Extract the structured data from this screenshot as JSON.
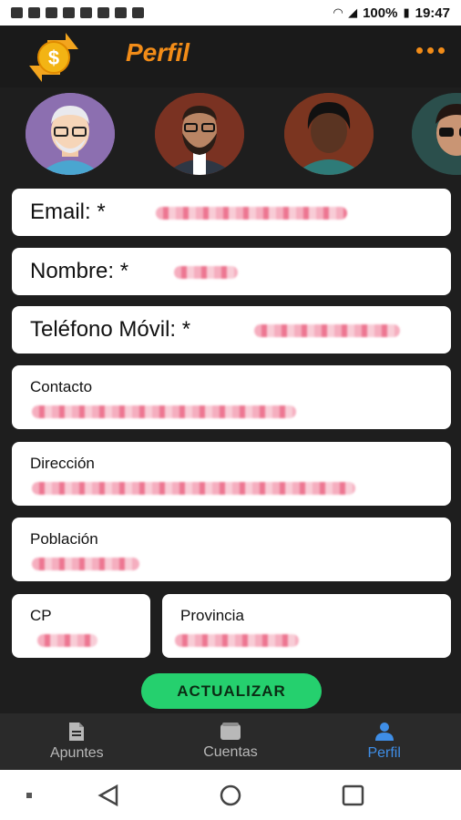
{
  "status_bar": {
    "battery": "100%",
    "time": "19:47"
  },
  "app_bar": {
    "title": "Perfil",
    "accent_color": "#f28c18",
    "logo_icon": "dollar-coin-arrows-icon",
    "menu_icon": "more-horizontal-icon"
  },
  "avatars": [
    {
      "name": "avatar-old-man"
    },
    {
      "name": "avatar-bearded-man"
    },
    {
      "name": "avatar-dark-hair-person"
    },
    {
      "name": "avatar-glasses-person"
    }
  ],
  "form": {
    "email_label": "Email: *",
    "nombre_label": "Nombre: *",
    "telefono_label": "Teléfono Móvil: *",
    "contacto_label": "Contacto",
    "direccion_label": "Dirección",
    "poblacion_label": "Población",
    "cp_label": "CP",
    "provincia_label": "Provincia"
  },
  "update_button": "ACTUALIZAR",
  "bottom_nav": {
    "items": [
      {
        "label": "Apuntes",
        "icon": "document-icon",
        "active": false
      },
      {
        "label": "Cuentas",
        "icon": "folder-icon",
        "active": false
      },
      {
        "label": "Perfil",
        "icon": "person-icon",
        "active": true
      }
    ],
    "active_color": "#3f8ee6"
  }
}
